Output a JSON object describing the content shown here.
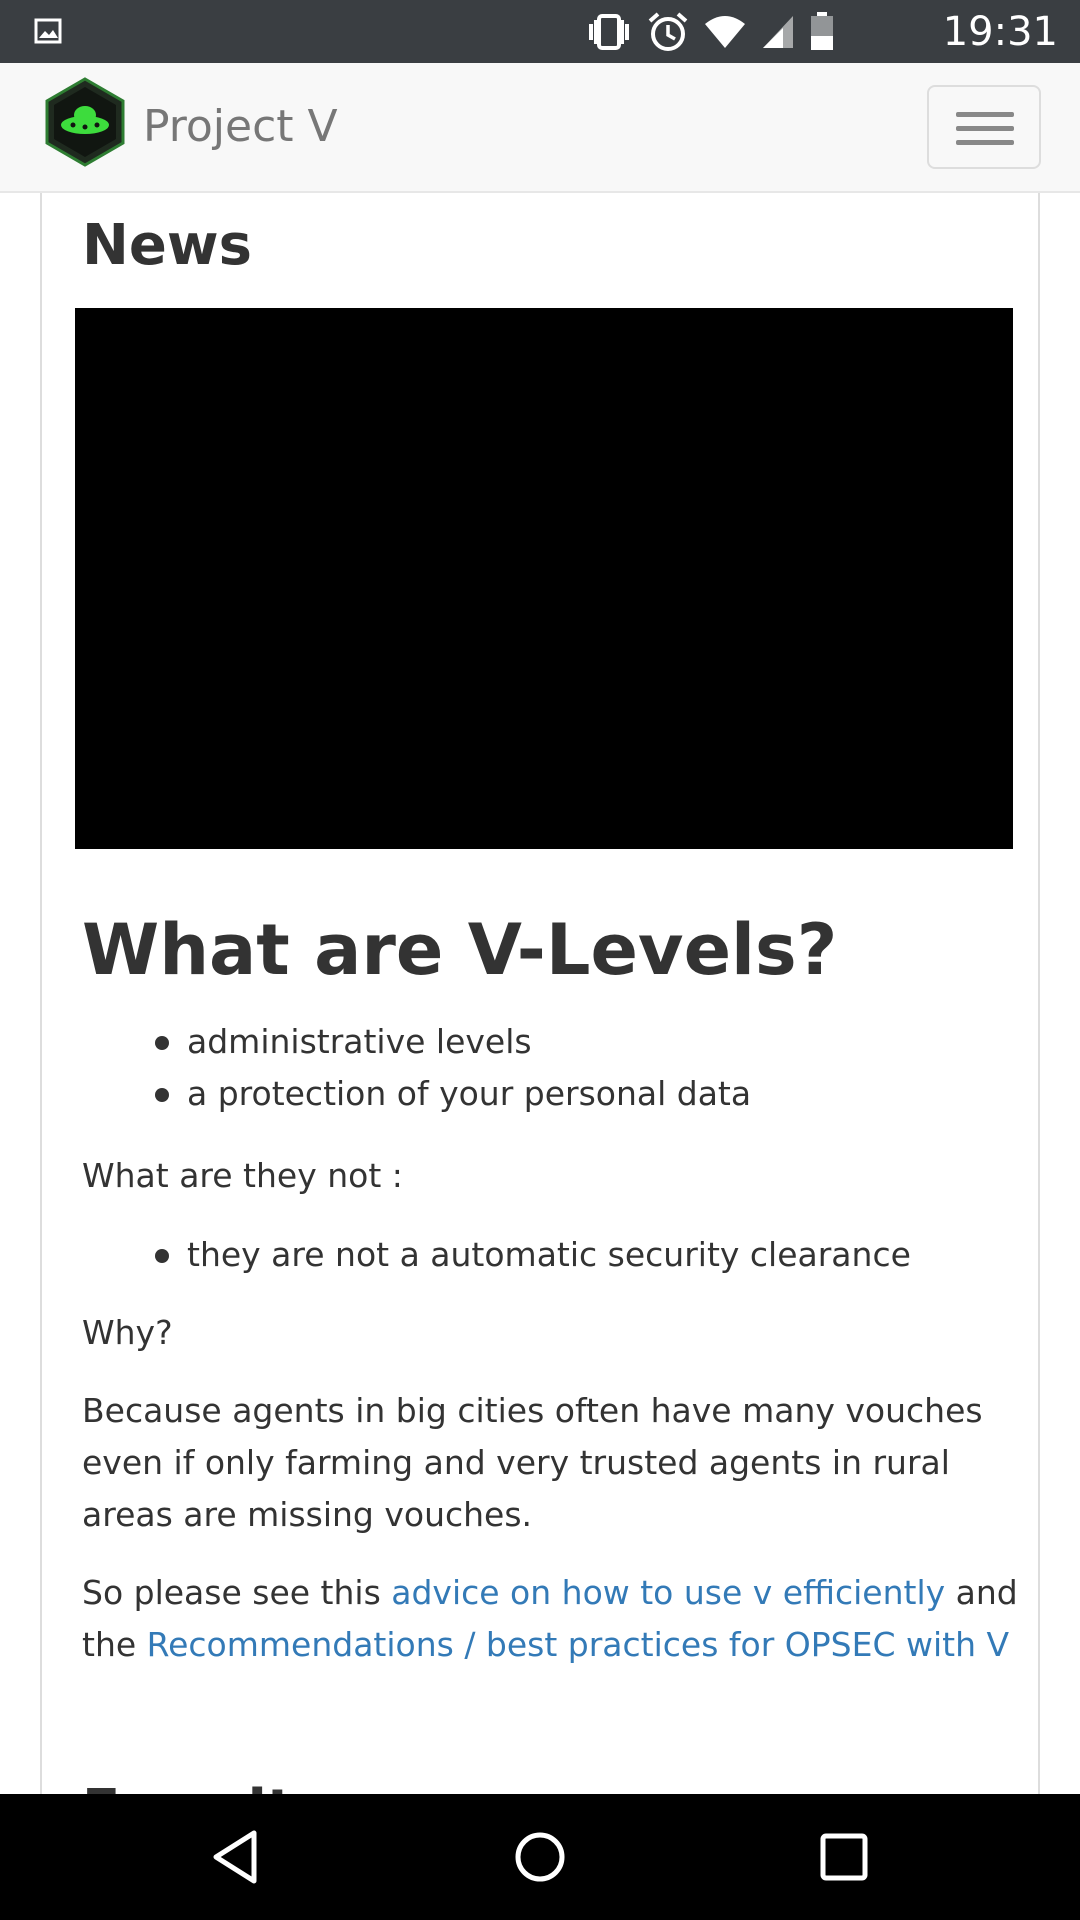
{
  "status_bar": {
    "time": "19:31",
    "icons": [
      "image-notification-icon",
      "vibrate-icon",
      "alarm-icon",
      "wifi-icon",
      "cell-signal-icon",
      "battery-icon"
    ]
  },
  "navbar": {
    "brand_name": "Project V",
    "logo_icon": "project-v-logo",
    "menu_icon": "hamburger-menu-icon"
  },
  "content": {
    "news_title": "News",
    "heading": "What are V-Levels?",
    "bullets_1": [
      "administrative levels",
      "a protection of your personal data"
    ],
    "what_not": "What are they not :",
    "bullets_2": [
      "they are not a automatic security clearance"
    ],
    "why": "Why?",
    "because": "Because agents in big cities often have many vouches even if only farming and very trusted agents in rural areas are missing vouches.",
    "advice": {
      "prefix": "So please see this ",
      "link1": "advice on how to use v efficiently",
      "middle": " and the ",
      "link2": "Recommendations / best practices for OPSEC with V"
    },
    "next_heading": "Faq sites"
  },
  "system_nav": {
    "icons": [
      "back-icon",
      "home-icon",
      "recents-icon"
    ]
  },
  "colors": {
    "status_bar_bg": "#3a3e42",
    "navbar_bg": "#f8f8f8",
    "link": "#337ab7",
    "text": "#333333",
    "logo_green": "#3ddc3d"
  }
}
